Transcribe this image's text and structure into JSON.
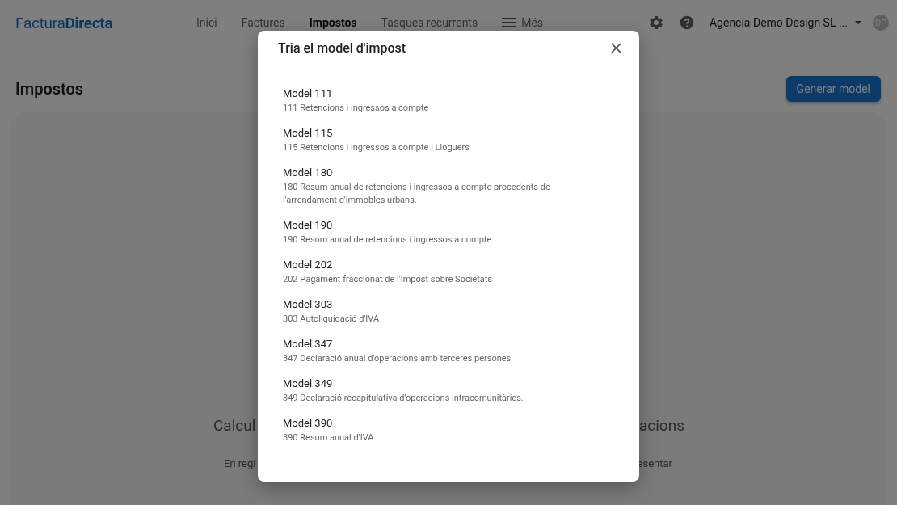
{
  "header": {
    "logo": "Factura**Directa**",
    "nav": [
      {
        "label": "Inici",
        "selected": false,
        "kind": "text"
      },
      {
        "label": "Factures",
        "selected": false,
        "kind": "text"
      },
      {
        "label": "Impostos",
        "selected": true,
        "kind": "text"
      },
      {
        "label": "Tasques recurrents",
        "selected": false,
        "kind": "text"
      },
      {
        "label": "Més",
        "selected": false,
        "kind": "menu"
      }
    ],
    "company": "Agencia Demo Design SL ...",
    "avatar": "DP"
  },
  "page": {
    "title": "Impostos",
    "primary_button": "Generar model",
    "card": {
      "heading_fragments": [
        "Calcul",
        "acions"
      ],
      "text_fragments": [
        "En regi",
        "esentar"
      ]
    }
  },
  "dialog": {
    "title": "Tria el model d'impost",
    "models": [
      {
        "name": "Model 111",
        "description": "111 Retencions i ingressos a compte"
      },
      {
        "name": "Model 115",
        "description": "115 Retencions i ingressos a compte i Lloguers"
      },
      {
        "name": "Model 180",
        "description": "180 Resum anual de retencions i ingressos a compte procedents de l'arrendament d'immobles urbans."
      },
      {
        "name": "Model 190",
        "description": "190 Resum anual de retencions i ingressos a compte"
      },
      {
        "name": "Model 202",
        "description": "202 Pagament fraccionat de l'Impost sobre Societats"
      },
      {
        "name": "Model 303",
        "description": "303 Autoliquidació d'IVA"
      },
      {
        "name": "Model 347",
        "description": "347 Declaració anual d'operacions amb terceres persones"
      },
      {
        "name": "Model 349",
        "description": "349 Declaració recapitulativa d'operacions intracomunitàries."
      },
      {
        "name": "Model 390",
        "description": "390 Resum anual d'IVA"
      }
    ]
  }
}
